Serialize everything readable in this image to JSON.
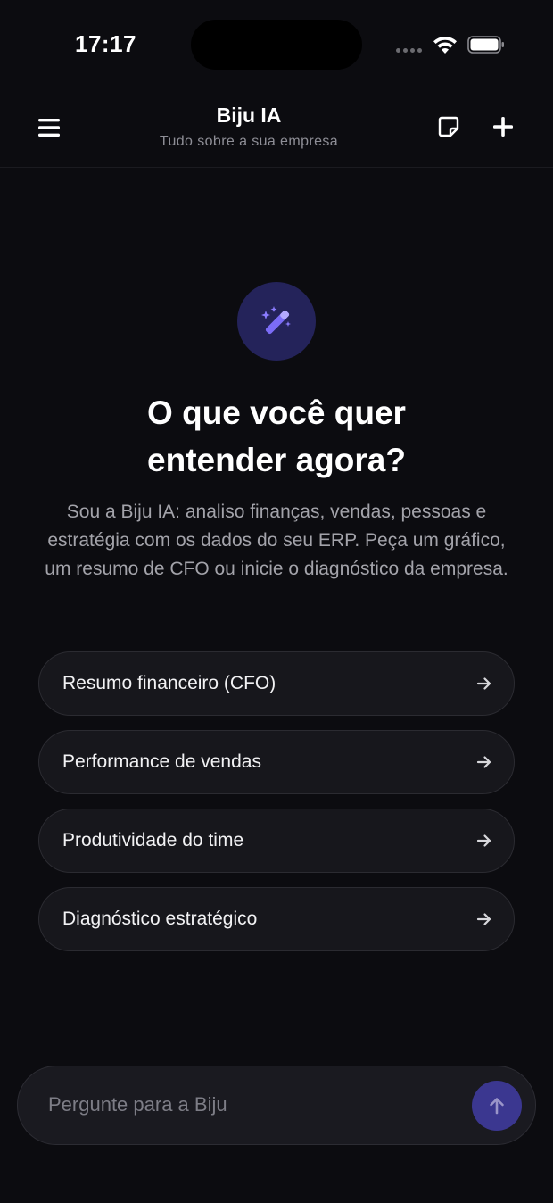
{
  "status_bar": {
    "time": "17:17"
  },
  "header": {
    "title": "Biju IA",
    "subtitle": "Tudo sobre a sua empresa",
    "icons": [
      "menu-icon",
      "note-icon",
      "plus-icon"
    ]
  },
  "hero": {
    "icon": "magic-wand-icon",
    "headline_line1": "O que você quer",
    "headline_line2": "entender agora?",
    "intro": "Sou a Biju IA: analiso finanças, vendas, pessoas e estratégia com os dados do seu ERP. Peça um gráfico, um resumo de CFO ou inicie o diagnóstico da empresa."
  },
  "suggestions": [
    {
      "label": "Resumo financeiro (CFO)",
      "icon": "arrow-right-icon"
    },
    {
      "label": "Performance de vendas",
      "icon": "arrow-right-icon"
    },
    {
      "label": "Produtividade do time",
      "icon": "arrow-right-icon"
    },
    {
      "label": "Diagnóstico estratégico",
      "icon": "arrow-right-icon"
    }
  ],
  "composer": {
    "placeholder": "Pergunte para a Biju",
    "value": "",
    "send_icon": "arrow-up-icon"
  },
  "colors": {
    "background": "#0c0c10",
    "accent": "#7b6cf6",
    "accent_dark": "#3b3790",
    "card": "#17171c"
  }
}
